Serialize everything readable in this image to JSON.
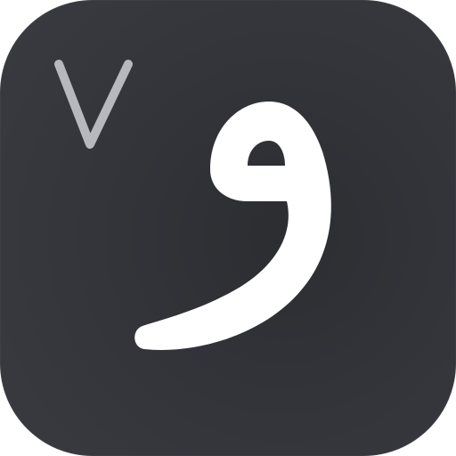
{
  "app_icon": {
    "background_color": "#333439",
    "logo_lettering": "و٧",
    "glyph_color": "#ffffff",
    "badge_numeral_color": "#b7b8bd"
  }
}
